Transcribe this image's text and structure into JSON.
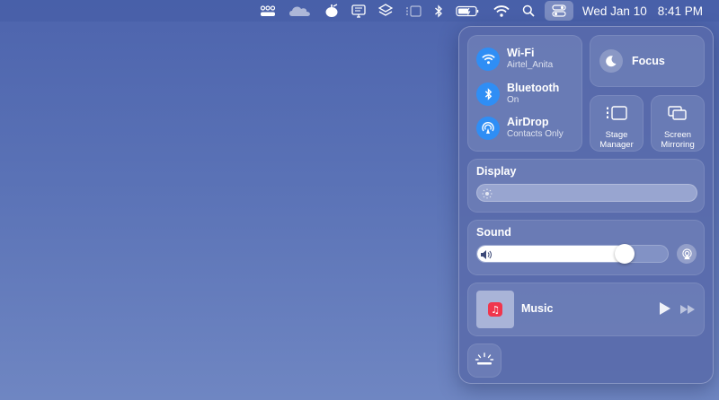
{
  "menubar": {
    "icons": [
      "mission-switcher-icon",
      "cloud-icon",
      "download-icon",
      "display-icon",
      "layers-icon",
      "stage-manager-icon",
      "bluetooth-icon",
      "battery-icon",
      "wifi-icon",
      "search-icon",
      "control-center-icon"
    ],
    "date": "Wed Jan 10",
    "time": "8:41 PM"
  },
  "control_center": {
    "wifi": {
      "title": "Wi-Fi",
      "subtitle": "Airtel_Anita",
      "icon": "wifi-icon"
    },
    "bluetooth": {
      "title": "Bluetooth",
      "subtitle": "On",
      "icon": "bluetooth-icon"
    },
    "airdrop": {
      "title": "AirDrop",
      "subtitle": "Contacts Only",
      "icon": "airdrop-icon"
    },
    "focus": {
      "label": "Focus",
      "icon": "moon-icon"
    },
    "stage_manager": {
      "label": "Stage Manager",
      "icon": "stage-manager-icon"
    },
    "screen_mirroring": {
      "label": "Screen Mirroring",
      "icon": "screen-mirroring-icon"
    },
    "display": {
      "title": "Display",
      "brightness": 0.0
    },
    "sound": {
      "title": "Sound",
      "volume": 0.8
    },
    "music": {
      "title": "Music"
    },
    "accent_color": "#2f8ef5",
    "music_badge_color": "#f0364d"
  }
}
